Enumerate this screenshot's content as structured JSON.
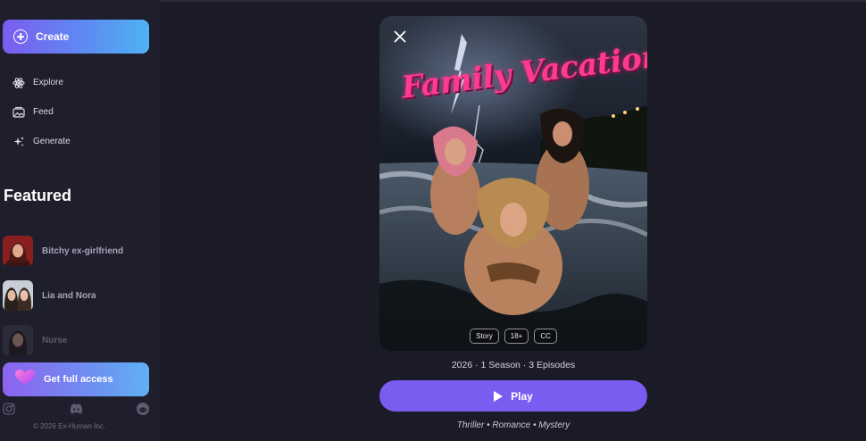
{
  "sidebar": {
    "create_label": "Create",
    "nav": [
      {
        "label": "Explore",
        "icon": "atom-icon"
      },
      {
        "label": "Feed",
        "icon": "feed-icon"
      },
      {
        "label": "Generate",
        "icon": "sparkles-icon"
      }
    ],
    "featured_title": "Featured",
    "featured": [
      {
        "name": "Bitchy ex-girlfriend"
      },
      {
        "name": "Lia and Nora"
      },
      {
        "name": "Nurse"
      }
    ],
    "access_label": "Get full access",
    "socials": [
      "instagram-icon",
      "discord-icon",
      "reddit-icon"
    ],
    "copyright": "© 2026 Ex-Human Inc."
  },
  "poster": {
    "title": "Family Vacation",
    "tags": [
      "Story",
      "18+",
      "CC"
    ]
  },
  "main": {
    "meta": "2026 · 1 Season · 3 Episodes",
    "play_label": "Play",
    "genres": "Thriller • Romance • Mystery"
  },
  "colors": {
    "accent": "#7b5cf0",
    "background": "#1b1a27",
    "sidebar": "#1f1e2c",
    "title_pink": "#ff3a8f"
  }
}
